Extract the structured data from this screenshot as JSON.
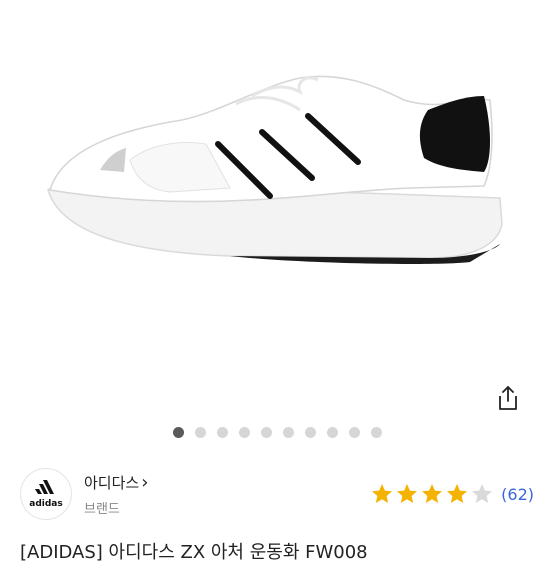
{
  "product": {
    "title": "[ADIDAS] 아디다스 ZX 아처 운동화 FW008"
  },
  "carousel": {
    "total": 10,
    "active_index": 0
  },
  "brand": {
    "name": "아디다스",
    "chevron": "›",
    "subtitle": "브랜드",
    "logo_text": "adidas"
  },
  "rating": {
    "score": 4,
    "max": 5,
    "count_text": "(62)"
  },
  "icons": {
    "share": "share-icon",
    "star": "star-icon"
  },
  "colors": {
    "star_filled": "#f5b301",
    "star_empty": "#d9d9d9",
    "count": "#3a66d6",
    "dot_active": "#5a5a5a",
    "dot_inactive": "#d6d6d6"
  }
}
